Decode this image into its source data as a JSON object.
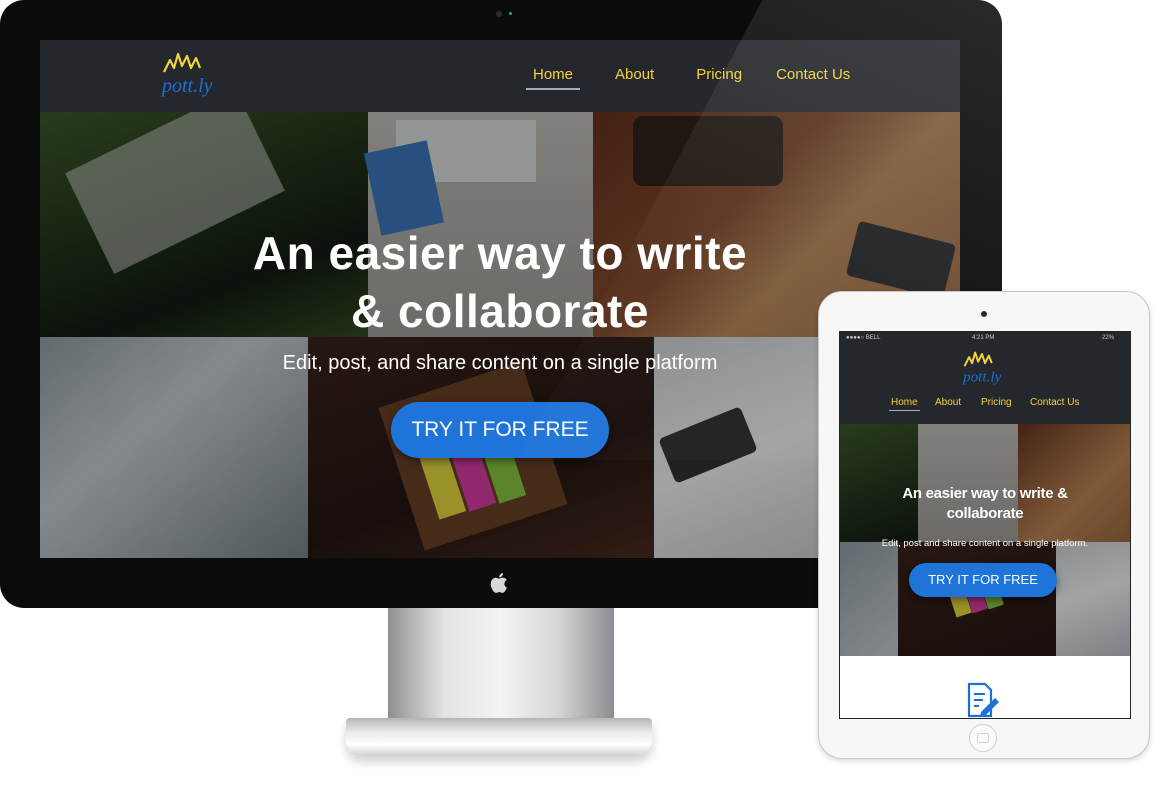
{
  "brand": {
    "logo_text": "pott.ly"
  },
  "nav": {
    "items": [
      {
        "label": "Home",
        "active": true
      },
      {
        "label": "About",
        "active": false
      },
      {
        "label": "Pricing",
        "active": false
      },
      {
        "label": "Contact Us",
        "active": false
      }
    ]
  },
  "hero": {
    "title_line1": "An easier way to write",
    "title_line2": "& collaborate",
    "subtitle": "Edit, post, and share content on a single platform",
    "cta_label": "TRY IT FOR FREE"
  },
  "tablet": {
    "status": {
      "carrier": "●●●●○ BELL",
      "time": "4:21 PM",
      "battery": "22%"
    },
    "hero_title_line1": "An easier way to write &",
    "hero_title_line2": "collaborate",
    "hero_subtitle": "Edit, post and share content on a single platform.",
    "cta_label": "TRY IT FOR FREE"
  },
  "colors": {
    "nav_bg": "#24272b",
    "nav_link": "#f4d23a",
    "cta_bg": "#1e74d8",
    "logo_blue": "#1f6fd6",
    "logo_yellow": "#f4d23a"
  },
  "icons": [
    "apple-logo-icon",
    "document-edit-icon",
    "ipad-home-button-icon"
  ]
}
